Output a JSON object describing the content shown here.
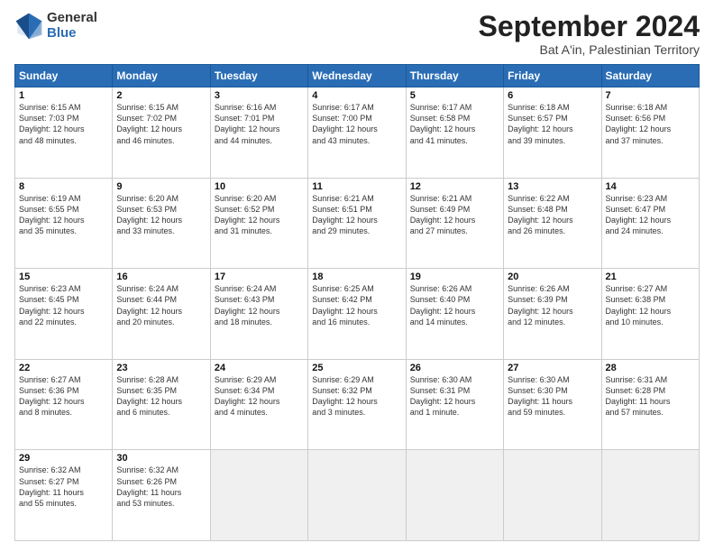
{
  "logo": {
    "general": "General",
    "blue": "Blue"
  },
  "header": {
    "month": "September 2024",
    "location": "Bat A'in, Palestinian Territory"
  },
  "days_header": [
    "Sunday",
    "Monday",
    "Tuesday",
    "Wednesday",
    "Thursday",
    "Friday",
    "Saturday"
  ],
  "weeks": [
    [
      {
        "day": "1",
        "lines": [
          "Sunrise: 6:15 AM",
          "Sunset: 7:03 PM",
          "Daylight: 12 hours",
          "and 48 minutes."
        ]
      },
      {
        "day": "2",
        "lines": [
          "Sunrise: 6:15 AM",
          "Sunset: 7:02 PM",
          "Daylight: 12 hours",
          "and 46 minutes."
        ]
      },
      {
        "day": "3",
        "lines": [
          "Sunrise: 6:16 AM",
          "Sunset: 7:01 PM",
          "Daylight: 12 hours",
          "and 44 minutes."
        ]
      },
      {
        "day": "4",
        "lines": [
          "Sunrise: 6:17 AM",
          "Sunset: 7:00 PM",
          "Daylight: 12 hours",
          "and 43 minutes."
        ]
      },
      {
        "day": "5",
        "lines": [
          "Sunrise: 6:17 AM",
          "Sunset: 6:58 PM",
          "Daylight: 12 hours",
          "and 41 minutes."
        ]
      },
      {
        "day": "6",
        "lines": [
          "Sunrise: 6:18 AM",
          "Sunset: 6:57 PM",
          "Daylight: 12 hours",
          "and 39 minutes."
        ]
      },
      {
        "day": "7",
        "lines": [
          "Sunrise: 6:18 AM",
          "Sunset: 6:56 PM",
          "Daylight: 12 hours",
          "and 37 minutes."
        ]
      }
    ],
    [
      {
        "day": "8",
        "lines": [
          "Sunrise: 6:19 AM",
          "Sunset: 6:55 PM",
          "Daylight: 12 hours",
          "and 35 minutes."
        ]
      },
      {
        "day": "9",
        "lines": [
          "Sunrise: 6:20 AM",
          "Sunset: 6:53 PM",
          "Daylight: 12 hours",
          "and 33 minutes."
        ]
      },
      {
        "day": "10",
        "lines": [
          "Sunrise: 6:20 AM",
          "Sunset: 6:52 PM",
          "Daylight: 12 hours",
          "and 31 minutes."
        ]
      },
      {
        "day": "11",
        "lines": [
          "Sunrise: 6:21 AM",
          "Sunset: 6:51 PM",
          "Daylight: 12 hours",
          "and 29 minutes."
        ]
      },
      {
        "day": "12",
        "lines": [
          "Sunrise: 6:21 AM",
          "Sunset: 6:49 PM",
          "Daylight: 12 hours",
          "and 27 minutes."
        ]
      },
      {
        "day": "13",
        "lines": [
          "Sunrise: 6:22 AM",
          "Sunset: 6:48 PM",
          "Daylight: 12 hours",
          "and 26 minutes."
        ]
      },
      {
        "day": "14",
        "lines": [
          "Sunrise: 6:23 AM",
          "Sunset: 6:47 PM",
          "Daylight: 12 hours",
          "and 24 minutes."
        ]
      }
    ],
    [
      {
        "day": "15",
        "lines": [
          "Sunrise: 6:23 AM",
          "Sunset: 6:45 PM",
          "Daylight: 12 hours",
          "and 22 minutes."
        ]
      },
      {
        "day": "16",
        "lines": [
          "Sunrise: 6:24 AM",
          "Sunset: 6:44 PM",
          "Daylight: 12 hours",
          "and 20 minutes."
        ]
      },
      {
        "day": "17",
        "lines": [
          "Sunrise: 6:24 AM",
          "Sunset: 6:43 PM",
          "Daylight: 12 hours",
          "and 18 minutes."
        ]
      },
      {
        "day": "18",
        "lines": [
          "Sunrise: 6:25 AM",
          "Sunset: 6:42 PM",
          "Daylight: 12 hours",
          "and 16 minutes."
        ]
      },
      {
        "day": "19",
        "lines": [
          "Sunrise: 6:26 AM",
          "Sunset: 6:40 PM",
          "Daylight: 12 hours",
          "and 14 minutes."
        ]
      },
      {
        "day": "20",
        "lines": [
          "Sunrise: 6:26 AM",
          "Sunset: 6:39 PM",
          "Daylight: 12 hours",
          "and 12 minutes."
        ]
      },
      {
        "day": "21",
        "lines": [
          "Sunrise: 6:27 AM",
          "Sunset: 6:38 PM",
          "Daylight: 12 hours",
          "and 10 minutes."
        ]
      }
    ],
    [
      {
        "day": "22",
        "lines": [
          "Sunrise: 6:27 AM",
          "Sunset: 6:36 PM",
          "Daylight: 12 hours",
          "and 8 minutes."
        ]
      },
      {
        "day": "23",
        "lines": [
          "Sunrise: 6:28 AM",
          "Sunset: 6:35 PM",
          "Daylight: 12 hours",
          "and 6 minutes."
        ]
      },
      {
        "day": "24",
        "lines": [
          "Sunrise: 6:29 AM",
          "Sunset: 6:34 PM",
          "Daylight: 12 hours",
          "and 4 minutes."
        ]
      },
      {
        "day": "25",
        "lines": [
          "Sunrise: 6:29 AM",
          "Sunset: 6:32 PM",
          "Daylight: 12 hours",
          "and 3 minutes."
        ]
      },
      {
        "day": "26",
        "lines": [
          "Sunrise: 6:30 AM",
          "Sunset: 6:31 PM",
          "Daylight: 12 hours",
          "and 1 minute."
        ]
      },
      {
        "day": "27",
        "lines": [
          "Sunrise: 6:30 AM",
          "Sunset: 6:30 PM",
          "Daylight: 11 hours",
          "and 59 minutes."
        ]
      },
      {
        "day": "28",
        "lines": [
          "Sunrise: 6:31 AM",
          "Sunset: 6:28 PM",
          "Daylight: 11 hours",
          "and 57 minutes."
        ]
      }
    ],
    [
      {
        "day": "29",
        "lines": [
          "Sunrise: 6:32 AM",
          "Sunset: 6:27 PM",
          "Daylight: 11 hours",
          "and 55 minutes."
        ]
      },
      {
        "day": "30",
        "lines": [
          "Sunrise: 6:32 AM",
          "Sunset: 6:26 PM",
          "Daylight: 11 hours",
          "and 53 minutes."
        ]
      },
      {
        "day": "",
        "lines": []
      },
      {
        "day": "",
        "lines": []
      },
      {
        "day": "",
        "lines": []
      },
      {
        "day": "",
        "lines": []
      },
      {
        "day": "",
        "lines": []
      }
    ]
  ]
}
